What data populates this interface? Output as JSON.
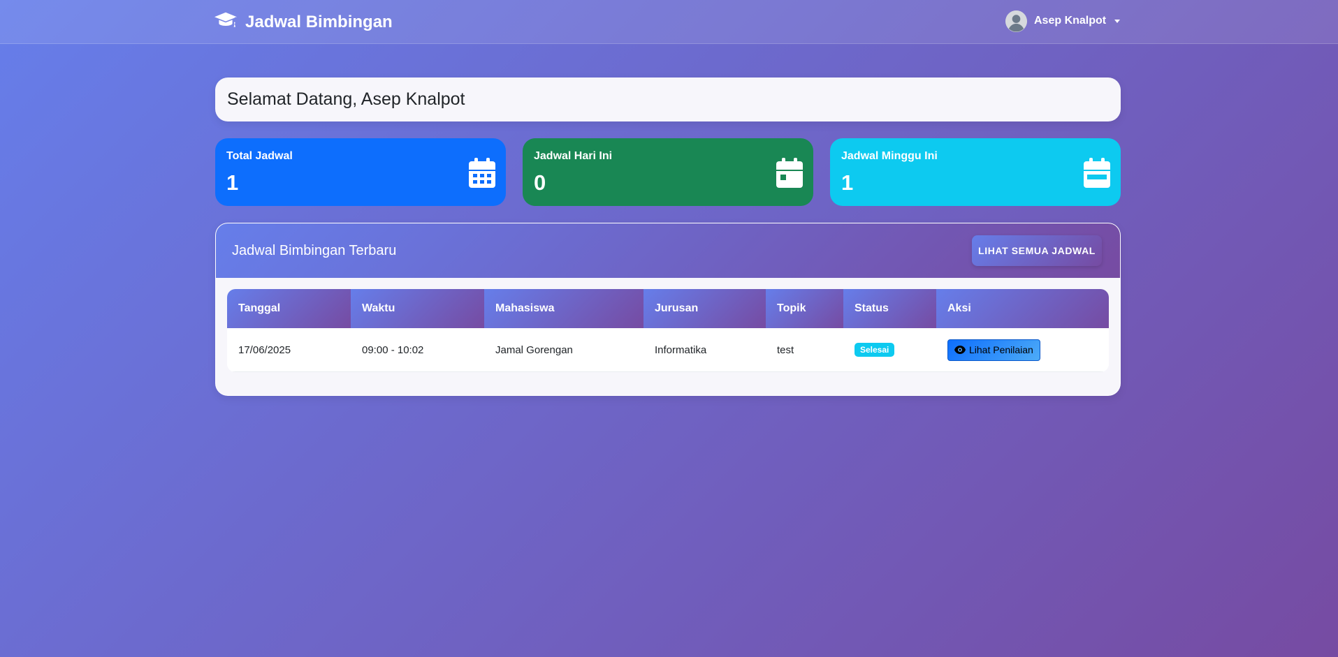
{
  "navbar": {
    "brand": "Jadwal Bimbingan",
    "brand_icon": "graduation-cap-icon",
    "user_name": "Asep Knalpot"
  },
  "welcome": {
    "text": "Selamat Datang, Asep Knalpot"
  },
  "stats": [
    {
      "label": "Total Jadwal",
      "value": "1",
      "icon": "calendar-days-icon",
      "color": "#0d6efd"
    },
    {
      "label": "Jadwal Hari Ini",
      "value": "0",
      "icon": "calendar-day-icon",
      "color": "#198754"
    },
    {
      "label": "Jadwal Minggu Ini",
      "value": "1",
      "icon": "calendar-week-icon",
      "color": "#0dcaf0"
    }
  ],
  "recent": {
    "title": "Jadwal Bimbingan Terbaru",
    "view_all_label": "LIHAT SEMUA JADWAL",
    "columns": [
      "Tanggal",
      "Waktu",
      "Mahasiswa",
      "Jurusan",
      "Topik",
      "Status",
      "Aksi"
    ],
    "rows": [
      {
        "tanggal": "17/06/2025",
        "waktu": "09:00 - 10:02",
        "mahasiswa": "Jamal Gorengan",
        "jurusan": "Informatika",
        "topik": "test",
        "status": "Selesai",
        "action_label": "Lihat Penilaian"
      }
    ]
  },
  "colors": {
    "gradient_start": "#667eea",
    "gradient_end": "#764ba2",
    "status_badge": "#0dcaf0"
  }
}
